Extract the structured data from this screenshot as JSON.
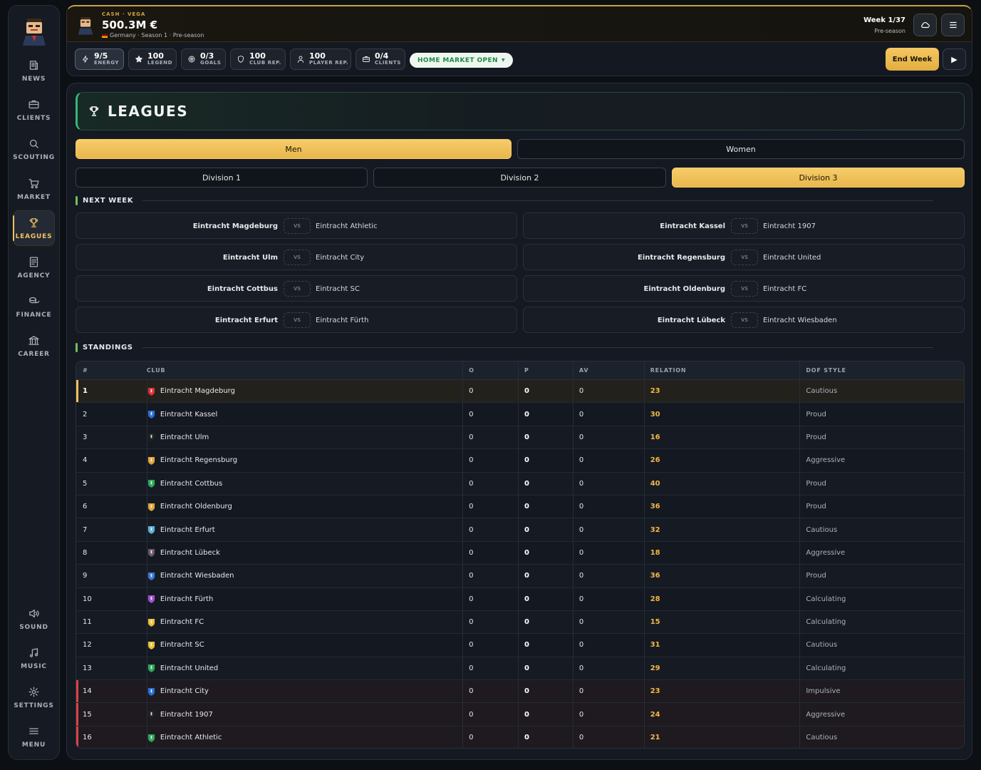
{
  "sidebar": {
    "items": [
      {
        "label": "NEWS",
        "icon": "newspaper-icon"
      },
      {
        "label": "CLIENTS",
        "icon": "briefcase-icon"
      },
      {
        "label": "SCOUTING",
        "icon": "search-icon"
      },
      {
        "label": "MARKET",
        "icon": "cart-icon"
      },
      {
        "label": "LEAGUES",
        "icon": "trophy-icon",
        "active": true
      },
      {
        "label": "AGENCY",
        "icon": "document-icon"
      },
      {
        "label": "FINANCE",
        "icon": "coins-icon"
      },
      {
        "label": "CAREER",
        "icon": "bank-icon"
      }
    ],
    "bottom_items": [
      {
        "label": "SOUND",
        "icon": "speaker-icon"
      },
      {
        "label": "MUSIC",
        "icon": "music-note-icon"
      },
      {
        "label": "SETTINGS",
        "icon": "gear-icon"
      },
      {
        "label": "MENU",
        "icon": "hamburger-icon"
      }
    ]
  },
  "topbar": {
    "cash_label": "CASH · VEGA",
    "cash_value": "500.3M €",
    "subtitle": "Germany · Season 1 · Pre-season",
    "week": "Week 1/37",
    "phase": "Pre-season"
  },
  "stats": [
    {
      "value": "9/5",
      "label": "ENERGY",
      "icon": "lightning-icon"
    },
    {
      "value": "100",
      "label": "LEGEND",
      "icon": "star-icon"
    },
    {
      "value": "0/3",
      "label": "GOALS",
      "icon": "target-icon"
    },
    {
      "value": "100",
      "label": "CLUB REP.",
      "icon": "shield-icon"
    },
    {
      "value": "100",
      "label": "PLAYER REP.",
      "icon": "person-icon"
    },
    {
      "value": "0/4",
      "label": "CLIENTS",
      "icon": "briefcase-icon"
    }
  ],
  "market_pill": "HOME MARKET OPEN",
  "end_week_label": "End Week",
  "page_title": "LEAGUES",
  "gender_tabs": [
    "Men",
    "Women"
  ],
  "division_tabs": [
    "Division 1",
    "Division 2",
    "Division 3"
  ],
  "next_week_title": "NEXT WEEK",
  "vs_label": "vs",
  "fixtures": [
    {
      "home": "Eintracht Magdeburg",
      "away": "Eintracht Athletic"
    },
    {
      "home": "Eintracht Kassel",
      "away": "Eintracht 1907"
    },
    {
      "home": "Eintracht Ulm",
      "away": "Eintracht City"
    },
    {
      "home": "Eintracht Regensburg",
      "away": "Eintracht United"
    },
    {
      "home": "Eintracht Cottbus",
      "away": "Eintracht SC"
    },
    {
      "home": "Eintracht Oldenburg",
      "away": "Eintracht FC"
    },
    {
      "home": "Eintracht Erfurt",
      "away": "Eintracht Fürth"
    },
    {
      "home": "Eintracht Lübeck",
      "away": "Eintracht Wiesbaden"
    }
  ],
  "standings_title": "STANDINGS",
  "columns": [
    "#",
    "CLUB",
    "O",
    "P",
    "AV",
    "RELATION",
    "DOF STYLE"
  ],
  "standings": [
    {
      "pos": "1",
      "club": "Eintracht Magdeburg",
      "o": "0",
      "p": "0",
      "av": "0",
      "relation": "23",
      "style": "Cautious",
      "color": "#d9333a"
    },
    {
      "pos": "2",
      "club": "Eintracht Kassel",
      "o": "0",
      "p": "0",
      "av": "0",
      "relation": "30",
      "style": "Proud",
      "color": "#2a6fd6"
    },
    {
      "pos": "3",
      "club": "Eintracht Ulm",
      "o": "0",
      "p": "0",
      "av": "0",
      "relation": "16",
      "style": "Proud",
      "color": "#222222"
    },
    {
      "pos": "4",
      "club": "Eintracht Regensburg",
      "o": "0",
      "p": "0",
      "av": "0",
      "relation": "26",
      "style": "Aggressive",
      "color": "#e0a53a"
    },
    {
      "pos": "5",
      "club": "Eintracht Cottbus",
      "o": "0",
      "p": "0",
      "av": "0",
      "relation": "40",
      "style": "Proud",
      "color": "#2ea85a"
    },
    {
      "pos": "6",
      "club": "Eintracht Oldenburg",
      "o": "0",
      "p": "0",
      "av": "0",
      "relation": "36",
      "style": "Proud",
      "color": "#e0a53a"
    },
    {
      "pos": "7",
      "club": "Eintracht Erfurt",
      "o": "0",
      "p": "0",
      "av": "0",
      "relation": "32",
      "style": "Cautious",
      "color": "#5fb0d8"
    },
    {
      "pos": "8",
      "club": "Eintracht Lübeck",
      "o": "0",
      "p": "0",
      "av": "0",
      "relation": "18",
      "style": "Aggressive",
      "color": "#6e5a66"
    },
    {
      "pos": "9",
      "club": "Eintracht Wiesbaden",
      "o": "0",
      "p": "0",
      "av": "0",
      "relation": "36",
      "style": "Proud",
      "color": "#3a78d8"
    },
    {
      "pos": "10",
      "club": "Eintracht Fürth",
      "o": "0",
      "p": "0",
      "av": "0",
      "relation": "28",
      "style": "Calculating",
      "color": "#a04fd0"
    },
    {
      "pos": "11",
      "club": "Eintracht FC",
      "o": "0",
      "p": "0",
      "av": "0",
      "relation": "15",
      "style": "Calculating",
      "color": "#e8c23a"
    },
    {
      "pos": "12",
      "club": "Eintracht SC",
      "o": "0",
      "p": "0",
      "av": "0",
      "relation": "31",
      "style": "Cautious",
      "color": "#e8c23a"
    },
    {
      "pos": "13",
      "club": "Eintracht United",
      "o": "0",
      "p": "0",
      "av": "0",
      "relation": "29",
      "style": "Calculating",
      "color": "#2ea85a"
    },
    {
      "pos": "14",
      "club": "Eintracht City",
      "o": "0",
      "p": "0",
      "av": "0",
      "relation": "23",
      "style": "Impulsive",
      "color": "#2a6fd6"
    },
    {
      "pos": "15",
      "club": "Eintracht 1907",
      "o": "0",
      "p": "0",
      "av": "0",
      "relation": "24",
      "style": "Aggressive",
      "color": "#222222"
    },
    {
      "pos": "16",
      "club": "Eintracht Athletic",
      "o": "0",
      "p": "0",
      "av": "0",
      "relation": "21",
      "style": "Cautious",
      "color": "#2ea85a"
    }
  ]
}
